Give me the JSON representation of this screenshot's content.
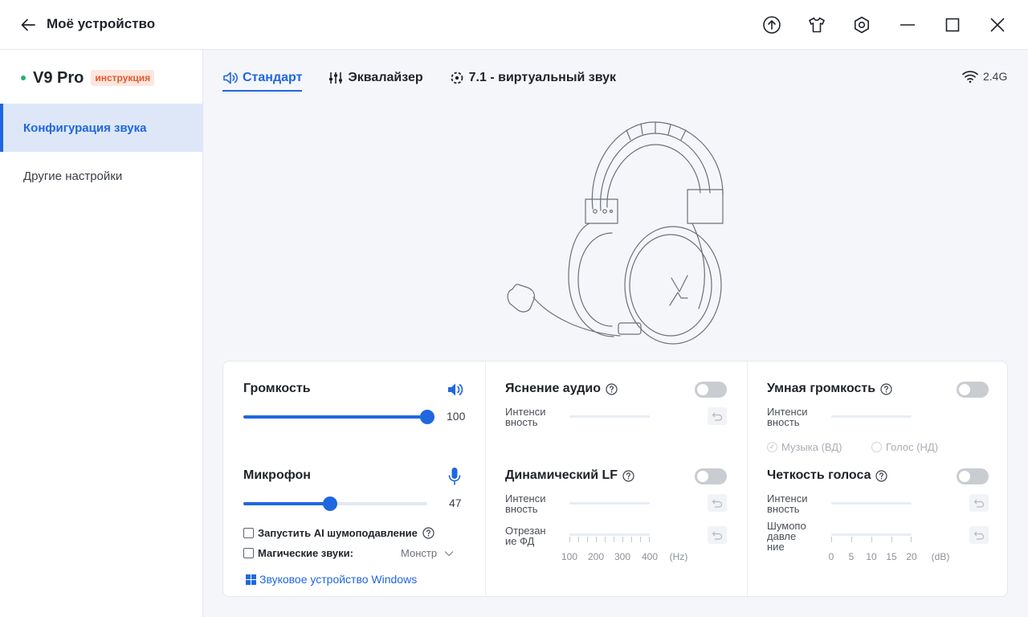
{
  "app": {
    "title": "Моё устройство"
  },
  "device": {
    "name": "V9 Pro",
    "badge": "инструкция"
  },
  "sidebar": {
    "items": [
      {
        "label": "Конфигурация звука",
        "active": true
      },
      {
        "label": "Другие настройки",
        "active": false
      }
    ]
  },
  "tabs": [
    {
      "label": "Стандарт",
      "icon": "speaker-icon",
      "active": true
    },
    {
      "label": "Эквалайзер",
      "icon": "equalizer-icon",
      "active": false
    },
    {
      "label": "7.1 - виртуальный звук",
      "icon": "surround-icon",
      "active": false
    }
  ],
  "connection": {
    "label": "2.4G",
    "icon": "wifi-icon"
  },
  "volume": {
    "label": "Громкость",
    "value": 100,
    "value_text": "100"
  },
  "microphone": {
    "label": "Микрофон",
    "value": 47,
    "value_text": "47"
  },
  "options": {
    "ai_noise": "Запустить AI шумоподавление",
    "magic_sounds": "Магические звуки:",
    "magic_value": "Монстр",
    "windows_link": "Звуковое устройство Windows"
  },
  "audio_clarity": {
    "label": "Яснение аудио",
    "intensity_label": "Интенси вность",
    "enabled": false
  },
  "dynamic_lf": {
    "label": "Динамический LF",
    "intensity_label": "Интенси вность",
    "cutoff_label": "Отрезан ие ФД",
    "ticks": [
      "100",
      "200",
      "300",
      "400"
    ],
    "unit": "(Hz)",
    "enabled": false
  },
  "smart_volume": {
    "label": "Умная громкость",
    "intensity_label": "Интенси вность",
    "option_music": "Музыка (ВД)",
    "option_voice": "Голос (НД)",
    "enabled": false
  },
  "voice_clarity": {
    "label": "Четкость голоса",
    "intensity_label": "Интенси вность",
    "noise_label": "Шумопо давле ние",
    "ticks": [
      "0",
      "5",
      "10",
      "15",
      "20"
    ],
    "unit": "(dB)",
    "enabled": false
  },
  "colors": {
    "accent": "#1f67e0",
    "badge": "#e4572e",
    "status": "#21b36b"
  }
}
